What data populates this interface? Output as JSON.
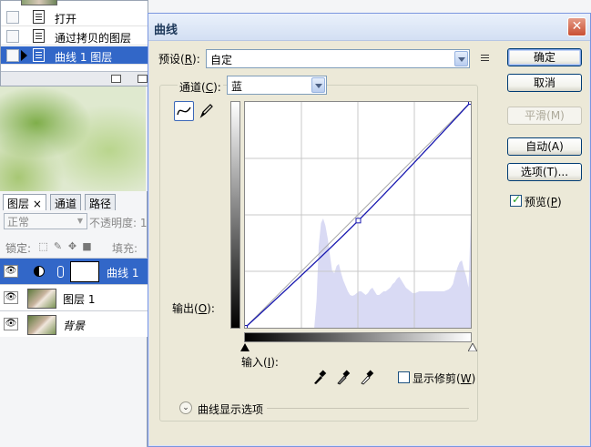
{
  "history": {
    "items": [
      {
        "label": "打开"
      },
      {
        "label": "通过拷贝的图层"
      },
      {
        "label": "曲线 1 图层"
      }
    ]
  },
  "layers": {
    "tabs": [
      "图层 ×",
      "通道",
      "路径"
    ],
    "blend_mode": "正常",
    "opacity_label": "不透明度:",
    "opacity_value": "1",
    "lock_label": "锁定:",
    "fill_label": "填充:",
    "rows": [
      {
        "name": "曲线 1"
      },
      {
        "name": "图层 1"
      },
      {
        "name": "背景"
      }
    ]
  },
  "dialog": {
    "title": "曲线",
    "close_glyph": "✕",
    "preset_label_pre": "预设(",
    "preset_key": "R",
    "preset_label_post": "):",
    "preset_value": "自定",
    "channel_label_pre": "通道(",
    "channel_key": "C",
    "channel_label_post": "):",
    "channel_value": "蓝",
    "buttons": {
      "ok": "确定",
      "cancel": "取消",
      "smooth": "平滑(M)",
      "auto": "自动(A)",
      "options": "选项(T)..."
    },
    "preview_pre": "预览(",
    "preview_key": "P",
    "preview_post": ")",
    "output_label_pre": "输出(",
    "output_key": "O",
    "output_label_post": "):",
    "input_label_pre": "输入(",
    "input_key": "I",
    "input_label_post": "):",
    "clip_label_pre": "显示修剪(",
    "clip_key": "W",
    "clip_label_post": ")",
    "curve_options_label": "曲线显示选项",
    "colors": {
      "histogram": "#d9daf4",
      "curve": "#1a1ab0",
      "grid": "#c8c8c8"
    }
  },
  "curve": {
    "points": [
      [
        0,
        0
      ],
      [
        128,
        121
      ],
      [
        255,
        255
      ]
    ]
  }
}
